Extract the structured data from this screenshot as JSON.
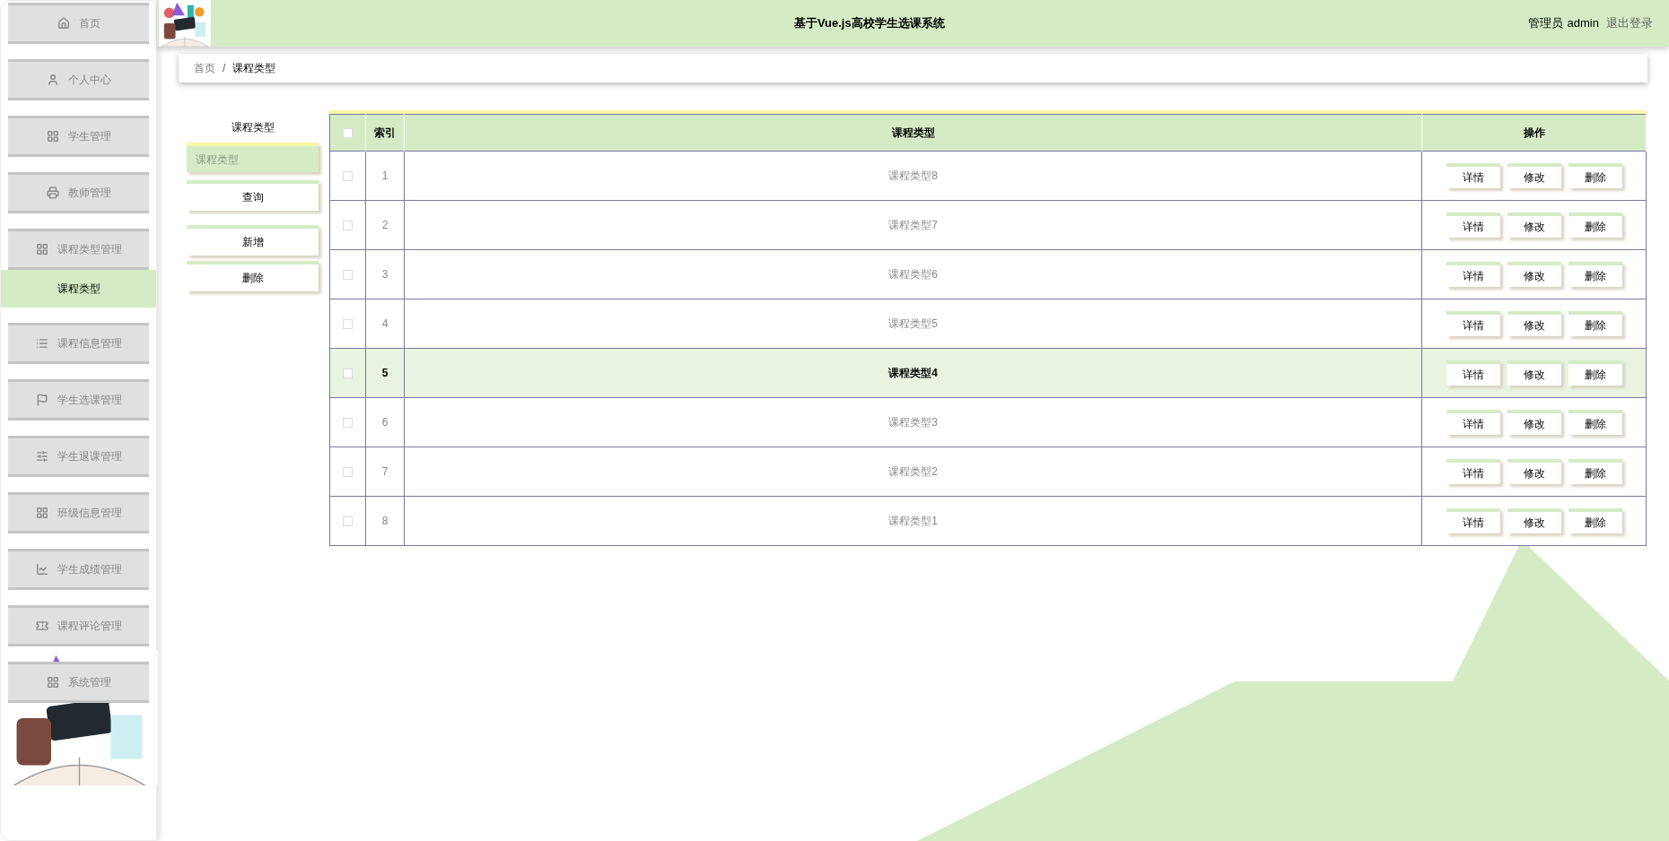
{
  "sidebar": {
    "items": [
      {
        "label": "首页"
      },
      {
        "label": "个人中心"
      },
      {
        "label": "学生管理"
      },
      {
        "label": "教师管理"
      },
      {
        "label": "课程类型管理",
        "children": [
          {
            "label": "课程类型",
            "selected": true
          }
        ]
      },
      {
        "label": "课程信息管理"
      },
      {
        "label": "学生选课管理"
      },
      {
        "label": "学生退课管理"
      },
      {
        "label": "班级信息管理"
      },
      {
        "label": "学生成绩管理"
      },
      {
        "label": "课程评论管理"
      },
      {
        "label": "系统管理"
      }
    ]
  },
  "header": {
    "title": "基于Vue.js高校学生选课系统",
    "role": "管理员",
    "user": "admin",
    "logout": "退出登录"
  },
  "breadcrumb": {
    "items": [
      "首页",
      "课程类型"
    ],
    "separator": "/"
  },
  "search": {
    "label": "课程类型",
    "placeholder": "课程类型",
    "buttons": [
      "查询",
      "新增",
      "删除"
    ]
  },
  "table": {
    "all_checked": false,
    "columns": [
      "索引",
      "课程类型",
      "操作"
    ],
    "rows": [
      {
        "index": "1",
        "type": "课程类型8",
        "selected": false,
        "checked": false,
        "actions": [
          "详情",
          "修改",
          "删除"
        ]
      },
      {
        "index": "2",
        "type": "课程类型7",
        "selected": false,
        "checked": false,
        "actions": [
          "详情",
          "修改",
          "删除"
        ]
      },
      {
        "index": "3",
        "type": "课程类型6",
        "selected": false,
        "checked": false,
        "actions": [
          "详情",
          "修改",
          "删除"
        ]
      },
      {
        "index": "4",
        "type": "课程类型5",
        "selected": false,
        "checked": false,
        "actions": [
          "详情",
          "修改",
          "删除"
        ]
      },
      {
        "index": "5",
        "type": "课程类型4",
        "selected": true,
        "checked": false,
        "actions": [
          "详情",
          "修改",
          "删除"
        ]
      },
      {
        "index": "6",
        "type": "课程类型3",
        "selected": false,
        "checked": false,
        "actions": [
          "详情",
          "修改",
          "删除"
        ]
      },
      {
        "index": "7",
        "type": "课程类型2",
        "selected": false,
        "checked": false,
        "actions": [
          "详情",
          "修改",
          "删除"
        ]
      },
      {
        "index": "8",
        "type": "课程类型1",
        "selected": false,
        "checked": false,
        "actions": [
          "详情",
          "修改",
          "删除"
        ]
      }
    ]
  }
}
